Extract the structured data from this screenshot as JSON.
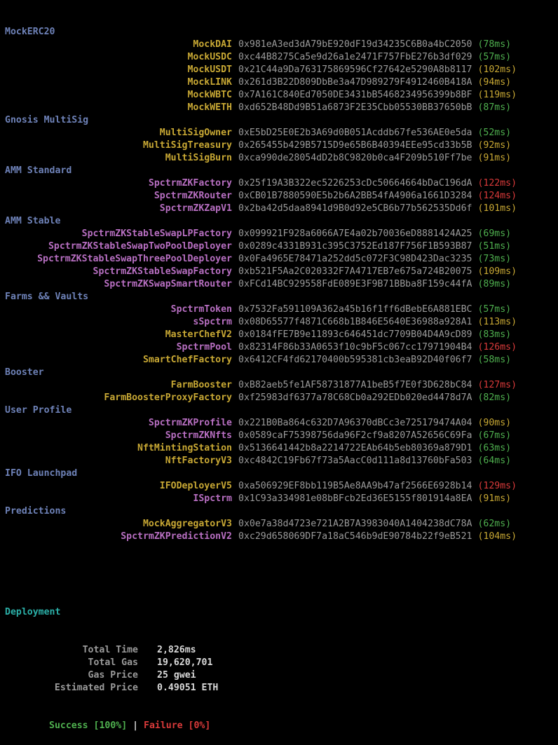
{
  "colors": {
    "name_gold": "#c8a834",
    "name_purple": "#b86fc2",
    "time_green": "#4fb04f",
    "time_yellow": "#c8a834",
    "time_red": "#d93a3a",
    "section_blue": "#6e82b8",
    "address_gray": "#9a9a9a",
    "deploy_teal": "#2bb0a8"
  },
  "sections": [
    {
      "title": "MockERC20",
      "contracts": [
        {
          "name": "MockDAI",
          "address": "0x981eA3ed3dA79bE920dF19d34235C6B0a4bC2050",
          "time": "(78ms)",
          "name_color": "gold",
          "time_color": "green"
        },
        {
          "name": "MockUSDC",
          "address": "0xc44B8275Ca5e9d26a1e2471F757FbE276b3df029",
          "time": "(57ms)",
          "name_color": "gold",
          "time_color": "green"
        },
        {
          "name": "MockUSDT",
          "address": "0x21C44a9Da763175869596Cf27642e5290A8b8117",
          "time": "(102ms)",
          "name_color": "gold",
          "time_color": "yellow"
        },
        {
          "name": "MockLINK",
          "address": "0x261d3B22D809DbBe3a47D989279F4912460B418A",
          "time": "(94ms)",
          "name_color": "gold",
          "time_color": "yellow"
        },
        {
          "name": "MockWBTC",
          "address": "0x7A161C840Ed7050DE3431bB5468234956399b8BF",
          "time": "(119ms)",
          "name_color": "gold",
          "time_color": "yellow"
        },
        {
          "name": "MockWETH",
          "address": "0xd652B48Dd9B51a6873F2E35Cbb05530BB37650bB",
          "time": "(87ms)",
          "name_color": "gold",
          "time_color": "green"
        }
      ]
    },
    {
      "title": "Gnosis MultiSig",
      "contracts": [
        {
          "name": "MultiSigOwner",
          "address": "0xE5bD25E0E2b3A69d0B051Acddb67fe536AE0e5da",
          "time": "(52ms)",
          "name_color": "gold",
          "time_color": "green"
        },
        {
          "name": "MultiSigTreasury",
          "address": "0x265455b429B5715D9e65B6B40394EEe95cd33b5B",
          "time": "(92ms)",
          "name_color": "gold",
          "time_color": "yellow"
        },
        {
          "name": "MultiSigBurn",
          "address": "0xca990de28054dD2b8C9820b0ca4F209b510Ff7be",
          "time": "(91ms)",
          "name_color": "gold",
          "time_color": "yellow"
        }
      ]
    },
    {
      "title": "AMM Standard",
      "contracts": [
        {
          "name": "SpctrmZKFactory",
          "address": "0x25f19A3B322ec5226253cDc50664664bDaC196dA",
          "time": "(122ms)",
          "name_color": "purple",
          "time_color": "red"
        },
        {
          "name": "SpctrmZKRouter",
          "address": "0xCB01B7880590E5b2b6A2BB54fA4906a1661D3284",
          "time": "(124ms)",
          "name_color": "purple",
          "time_color": "red"
        },
        {
          "name": "SpctrmZKZapV1",
          "address": "0x2ba42d5daa8941d9B0d92e5CB6b77b562535Dd6f",
          "time": "(101ms)",
          "name_color": "purple",
          "time_color": "yellow"
        }
      ]
    },
    {
      "title": "AMM Stable",
      "contracts": [
        {
          "name": "SpctrmZKStableSwapLPFactory",
          "address": "0x099921F928a6066A7E4a02b70036eD8881424A25",
          "time": "(69ms)",
          "name_color": "purple",
          "time_color": "green"
        },
        {
          "name": "SpctrmZKStableSwapTwoPoolDeployer",
          "address": "0x0289c4331B931c395C3752Ed187F756F1B593B87",
          "time": "(51ms)",
          "name_color": "purple",
          "time_color": "green"
        },
        {
          "name": "SpctrmZKStableSwapThreePoolDeployer",
          "address": "0x0Fa4965E78471a252dd5c072F3C98D423Dac3235",
          "time": "(73ms)",
          "name_color": "purple",
          "time_color": "green"
        },
        {
          "name": "SpctrmZKStableSwapFactory",
          "address": "0xb521F5Aa2C020332F7A4717EB7e675a724B20075",
          "time": "(109ms)",
          "name_color": "purple",
          "time_color": "yellow"
        },
        {
          "name": "SpctrmZKSwapSmartRouter",
          "address": "0xFCd14BC929558FdE089E3F9B71BBba8F159c44fA",
          "time": "(89ms)",
          "name_color": "purple",
          "time_color": "green"
        }
      ]
    },
    {
      "title": "Farms && Vaults",
      "contracts": [
        {
          "name": "SpctrmToken",
          "address": "0x7532Fa591109A362a45b16f1ff6dBebE6A881EBC",
          "time": "(57ms)",
          "name_color": "purple",
          "time_color": "green"
        },
        {
          "name": "sSpctrm",
          "address": "0x08D65577f4871C668b1B846E5640E36988a928A1",
          "time": "(113ms)",
          "name_color": "purple",
          "time_color": "yellow"
        },
        {
          "name": "MasterChefV2",
          "address": "0x0184fFE7B9e11893c646451dc7709B04D4A9cD89",
          "time": "(83ms)",
          "name_color": "gold",
          "time_color": "green"
        },
        {
          "name": "SpctrmPool",
          "address": "0x82314F86b33A0653f10c9bF5c067cc17971904B4",
          "time": "(126ms)",
          "name_color": "purple",
          "time_color": "red"
        },
        {
          "name": "SmartChefFactory",
          "address": "0x6412CF4fd62170400b595381cb3eaB92D40f06f7",
          "time": "(58ms)",
          "name_color": "gold",
          "time_color": "green"
        }
      ]
    },
    {
      "title": "Booster",
      "contracts": [
        {
          "name": "FarmBooster",
          "address": "0xB82aeb5fe1AF58731877A1beB5f7E0f3D628bC84",
          "time": "(127ms)",
          "name_color": "gold",
          "time_color": "red"
        },
        {
          "name": "FarmBoosterProxyFactory",
          "address": "0xf25983df6377a78C68Cb0a292EDb020ed4478d7A",
          "time": "(82ms)",
          "name_color": "gold",
          "time_color": "green"
        }
      ]
    },
    {
      "title": "User Profile",
      "contracts": [
        {
          "name": "SpctrmZKProfile",
          "address": "0x221B0Ba864c632D7A96370dBCc3e725179474A04",
          "time": "(90ms)",
          "name_color": "purple",
          "time_color": "yellow"
        },
        {
          "name": "SpctrmZKNfts",
          "address": "0x0589caF75398756da96F2cf9a8207A52656C69Fa",
          "time": "(67ms)",
          "name_color": "purple",
          "time_color": "green"
        },
        {
          "name": "NftMintingStation",
          "address": "0x5136641442b8a2214722EAb64b5eb80369a879D1",
          "time": "(63ms)",
          "name_color": "gold",
          "time_color": "green"
        },
        {
          "name": "NftFactoryV3",
          "address": "0xc4842C19Fb67f73a5AacC0d111a8d13760bFa503",
          "time": "(64ms)",
          "name_color": "gold",
          "time_color": "green"
        }
      ]
    },
    {
      "title": "IFO Launchpad",
      "contracts": [
        {
          "name": "IFODeployerV5",
          "address": "0xa506929EF8bb119B5Ae8AA9b47af2566E6928b14",
          "time": "(129ms)",
          "name_color": "gold",
          "time_color": "red"
        },
        {
          "name": "ISpctrm",
          "address": "0x1C93a334981e08bBFcb2Ed36E5155f801914a8EA",
          "time": "(91ms)",
          "name_color": "purple",
          "time_color": "yellow"
        }
      ]
    },
    {
      "title": "Predictions",
      "contracts": [
        {
          "name": "MockAggregatorV3",
          "address": "0x0e7a38d4723e721A2B7A3983040A1404238dC78A",
          "time": "(62ms)",
          "name_color": "gold",
          "time_color": "green"
        },
        {
          "name": "SpctrmZKPredictionV2",
          "address": "0xc29d658069DF7a18aC546b9dE90784b22f9eB521",
          "time": "(104ms)",
          "name_color": "purple",
          "time_color": "yellow"
        }
      ]
    }
  ],
  "deployment": {
    "title": "Deployment",
    "stats": [
      {
        "label": "Total Time",
        "value": "2,826ms"
      },
      {
        "label": "Total Gas",
        "value": "19,620,701"
      },
      {
        "label": "Gas Price",
        "value": "25 gwei"
      },
      {
        "label": "Estimated Price",
        "value": "0.49051 ETH"
      }
    ],
    "success": "Success [100%]",
    "separator": "|",
    "failure": "Failure [0%]"
  }
}
